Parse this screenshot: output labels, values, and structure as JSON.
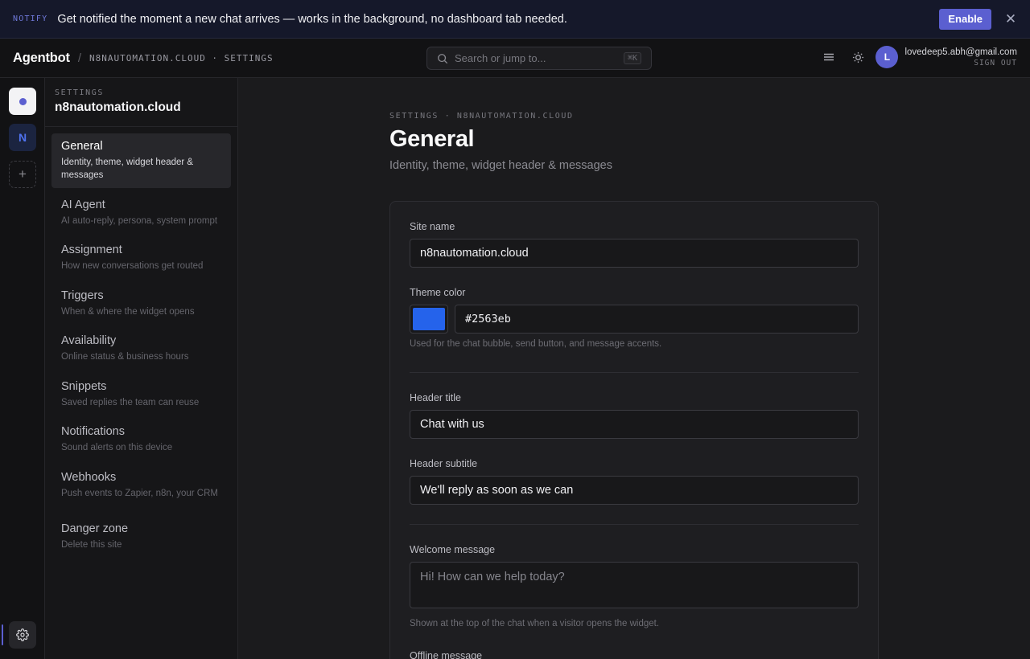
{
  "notify": {
    "tag": "NOTIFY",
    "message": "Get notified the moment a new chat arrives — works in the background, no dashboard tab needed.",
    "enable_label": "Enable",
    "close_icon": "close-icon"
  },
  "topbar": {
    "brand": "Agentbot",
    "separator": "/",
    "crumb": "N8NAUTOMATION.CLOUD · SETTINGS",
    "search_placeholder": "Search or jump to...",
    "search_shortcut": "⌘K",
    "user_initial": "L",
    "user_email": "lovedeep5.abh@gmail.com",
    "sign_out": "SIGN OUT"
  },
  "rail": {
    "site_initial": "N",
    "add_label": "+"
  },
  "settings_nav": {
    "label": "SETTINGS",
    "site": "n8nautomation.cloud",
    "items": [
      {
        "title": "General",
        "desc": "Identity, theme, widget header & messages",
        "active": true
      },
      {
        "title": "AI Agent",
        "desc": "AI auto-reply, persona, system prompt"
      },
      {
        "title": "Assignment",
        "desc": "How new conversations get routed"
      },
      {
        "title": "Triggers",
        "desc": "When & where the widget opens"
      },
      {
        "title": "Availability",
        "desc": "Online status & business hours"
      },
      {
        "title": "Snippets",
        "desc": "Saved replies the team can reuse"
      },
      {
        "title": "Notifications",
        "desc": "Sound alerts on this device"
      },
      {
        "title": "Webhooks",
        "desc": "Push events to Zapier, n8n, your CRM"
      },
      {
        "title": "Danger zone",
        "desc": "Delete this site"
      }
    ]
  },
  "main": {
    "eyebrow": "SETTINGS · N8NAUTOMATION.CLOUD",
    "title": "General",
    "subtitle": "Identity, theme, widget header & messages",
    "form": {
      "site_name_label": "Site name",
      "site_name_value": "n8nautomation.cloud",
      "theme_color_label": "Theme color",
      "theme_color_value": "#2563eb",
      "theme_color_help": "Used for the chat bubble, send button, and message accents.",
      "header_title_label": "Header title",
      "header_title_value": "Chat with us",
      "header_subtitle_label": "Header subtitle",
      "header_subtitle_value": "We'll reply as soon as we can",
      "welcome_label": "Welcome message",
      "welcome_value": "Hi! How can we help today?",
      "welcome_help": "Shown at the top of the chat when a visitor opens the widget.",
      "offline_label": "Offline message"
    }
  },
  "colors": {
    "accent": "#5b5fd0",
    "theme": "#2563eb",
    "background": "#1b1b1d"
  }
}
